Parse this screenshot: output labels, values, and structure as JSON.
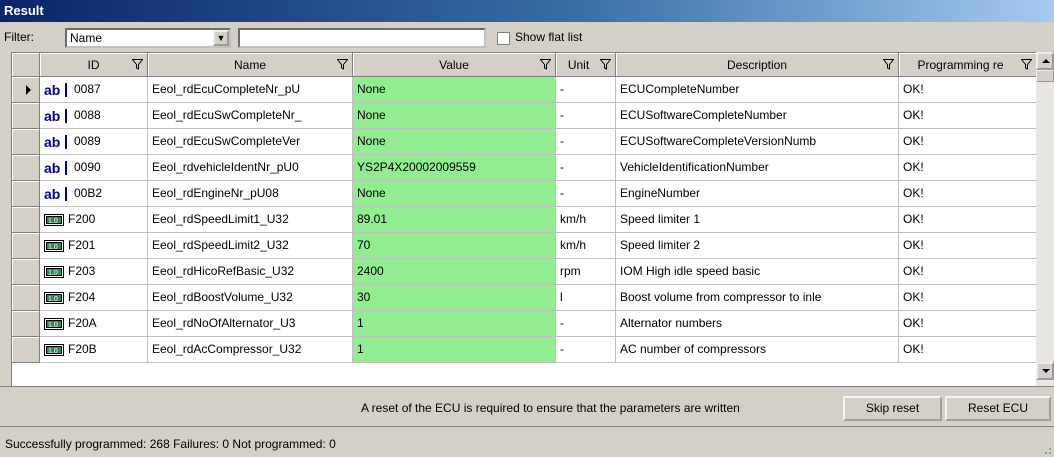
{
  "window": {
    "title": "Result"
  },
  "filter": {
    "label": "Filter:",
    "selected": "Name",
    "text_value": "",
    "show_flat_list_label": "Show flat list",
    "show_flat_list_checked": false
  },
  "columns": [
    "ID",
    "Name",
    "Value",
    "Unit",
    "Description",
    "Programming re"
  ],
  "rows": [
    {
      "type": "text",
      "id": "0087",
      "name": "Eeol_rdEcuCompleteNr_pU",
      "value": "None",
      "unit": "-",
      "description": "ECUCompleteNumber",
      "prog": "OK!"
    },
    {
      "type": "text",
      "id": "0088",
      "name": "Eeol_rdEcuSwCompleteNr_",
      "value": "None",
      "unit": "-",
      "description": "ECUSoftwareCompleteNumber",
      "prog": "OK!"
    },
    {
      "type": "text",
      "id": "0089",
      "name": "Eeol_rdEcuSwCompleteVer",
      "value": "None",
      "unit": "-",
      "description": "ECUSoftwareCompleteVersionNumb",
      "prog": "OK!"
    },
    {
      "type": "text",
      "id": "0090",
      "name": "Eeol_rdvehicleIdentNr_pU0",
      "value": "YS2P4X20002009559",
      "unit": "-",
      "description": "VehicleIdentificationNumber",
      "prog": "OK!"
    },
    {
      "type": "text",
      "id": "00B2",
      "name": "Eeol_rdEngineNr_pU08",
      "value": "None",
      "unit": "-",
      "description": "EngineNumber",
      "prog": "OK!"
    },
    {
      "type": "numeric",
      "id": "F200",
      "name": "Eeol_rdSpeedLimit1_U32",
      "value": "89.01",
      "unit": "km/h",
      "description": "Speed limiter 1",
      "prog": "OK!"
    },
    {
      "type": "numeric",
      "id": "F201",
      "name": "Eeol_rdSpeedLimit2_U32",
      "value": "70",
      "unit": "km/h",
      "description": "Speed limiter 2",
      "prog": "OK!"
    },
    {
      "type": "numeric",
      "id": "F203",
      "name": "Eeol_rdHicoRefBasic_U32",
      "value": "2400",
      "unit": "rpm",
      "description": "IOM High idle speed  basic",
      "prog": "OK!"
    },
    {
      "type": "numeric",
      "id": "F204",
      "name": "Eeol_rdBoostVolume_U32",
      "value": "30",
      "unit": "l",
      "description": "Boost volume from compressor to inle",
      "prog": "OK!"
    },
    {
      "type": "numeric",
      "id": "F20A",
      "name": "Eeol_rdNoOfAlternator_U3",
      "value": "1",
      "unit": "-",
      "description": "Alternator numbers",
      "prog": "OK!"
    },
    {
      "type": "numeric",
      "id": "F20B",
      "name": "Eeol_rdAcCompressor_U32",
      "value": "1",
      "unit": "-",
      "description": "AC number of compressors",
      "prog": "OK!"
    }
  ],
  "footer": {
    "reset_message": "A reset of the ECU is required to ensure that the parameters are written",
    "skip_reset_label": "Skip reset",
    "reset_ecu_label": "Reset ECU"
  },
  "status_text": "Successfully programmed: 268  Failures: 0  Not programmed: 0",
  "colors": {
    "value_bg": "#90ee90",
    "title_bg": "#0a246a"
  },
  "icons": {
    "text_row": "text-field-icon",
    "numeric_row": "numeric-field-icon"
  }
}
